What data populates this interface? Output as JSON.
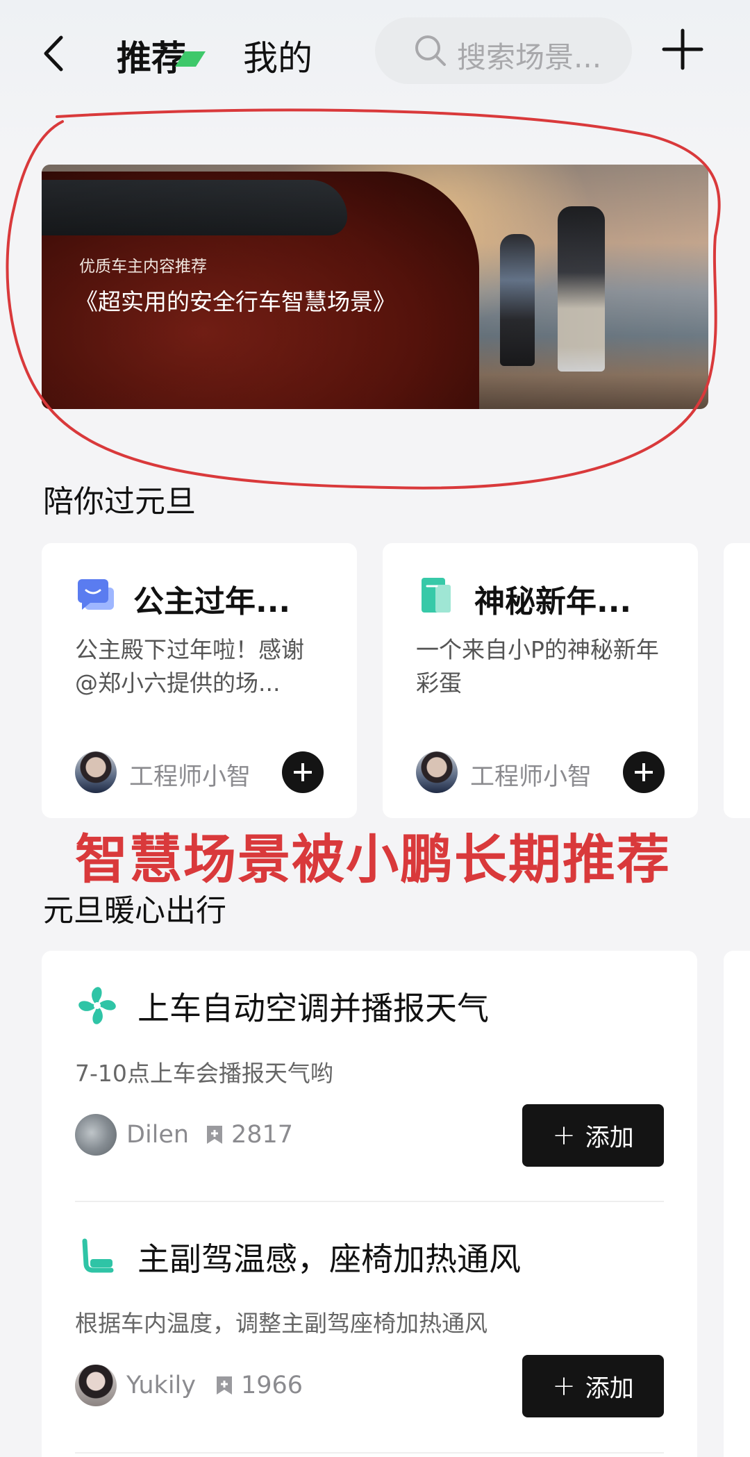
{
  "header": {
    "tabs": [
      "推荐",
      "我的"
    ],
    "search_placeholder": "搜索场景..."
  },
  "banner": {
    "subtitle": "优质车主内容推荐",
    "title": "《超实用的安全行车智慧场景》"
  },
  "section1": {
    "title": "陪你过元旦",
    "cards": [
      {
        "icon": "chat-bubble-icon",
        "title": "公主过年...",
        "desc": "公主殿下过年啦！感谢@郑小六提供的场...",
        "author": "工程师小智"
      },
      {
        "icon": "book-icon",
        "title": "神秘新年...",
        "desc": "一个来自小P的神秘新年彩蛋",
        "author": "工程师小智"
      }
    ]
  },
  "annotation": {
    "caption": "智慧场景被小鹏长期推荐",
    "color": "#d9393b"
  },
  "section2": {
    "title": "元旦暖心出行",
    "items": [
      {
        "icon": "fan-icon",
        "title": "上车自动空调并播报天气",
        "desc": "7-10点上车会播报天气哟",
        "user": "Dilen",
        "count": "2817",
        "add_label": "添加"
      },
      {
        "icon": "seat-icon",
        "title": "主副驾温感，座椅加热通风",
        "desc": "根据车内温度，调整主副驾座椅加热通风",
        "user": "Yukily",
        "count": "1966",
        "add_label": "添加"
      }
    ]
  },
  "colors": {
    "accent": "#2fc4a6",
    "button_bg": "#141414",
    "annotation_red": "#d9393b"
  }
}
